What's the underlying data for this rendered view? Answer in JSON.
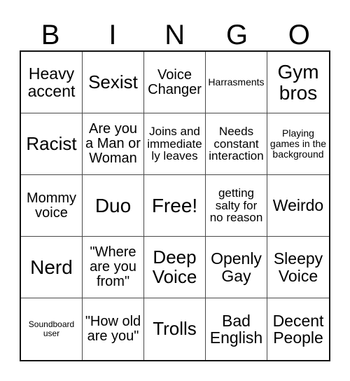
{
  "header": {
    "letters": [
      "B",
      "I",
      "N",
      "G",
      "O"
    ]
  },
  "grid": {
    "rows": 5,
    "columns": 5,
    "cells": [
      {
        "text": "Heavy accent",
        "size": "lg"
      },
      {
        "text": "Sexist",
        "size": "xl"
      },
      {
        "text": "Voice Changer",
        "size": "md"
      },
      {
        "text": "Harrasments",
        "size": "xs"
      },
      {
        "text": "Gym bros",
        "size": "xxl"
      },
      {
        "text": "Racist",
        "size": "xl"
      },
      {
        "text": "Are you a Man or Woman",
        "size": "md"
      },
      {
        "text": "Joins and immediately leaves",
        "size": "sm"
      },
      {
        "text": "Needs constant interaction",
        "size": "sm"
      },
      {
        "text": "Playing games in the background",
        "size": "xs"
      },
      {
        "text": "Mommy voice",
        "size": "md"
      },
      {
        "text": "Duo",
        "size": "xxl"
      },
      {
        "text": "Free!",
        "size": "xxl"
      },
      {
        "text": "getting salty for no reason",
        "size": "sm"
      },
      {
        "text": "Weirdo",
        "size": "lg"
      },
      {
        "text": "Nerd",
        "size": "xxl"
      },
      {
        "text": "\"Where are you from\"",
        "size": "md"
      },
      {
        "text": "Deep Voice",
        "size": "xl"
      },
      {
        "text": "Openly Gay",
        "size": "lg"
      },
      {
        "text": "Sleepy Voice",
        "size": "lg"
      },
      {
        "text": "Soundboard user",
        "size": "xxs"
      },
      {
        "text": "\"How old are you\"",
        "size": "md"
      },
      {
        "text": "Trolls",
        "size": "xl"
      },
      {
        "text": "Bad English",
        "size": "lg"
      },
      {
        "text": "Decent People",
        "size": "lg"
      }
    ]
  },
  "colors": {
    "background": "#ffffff",
    "text": "#000000",
    "outer_border": "#141414",
    "inner_border": "#4a4a4a"
  }
}
